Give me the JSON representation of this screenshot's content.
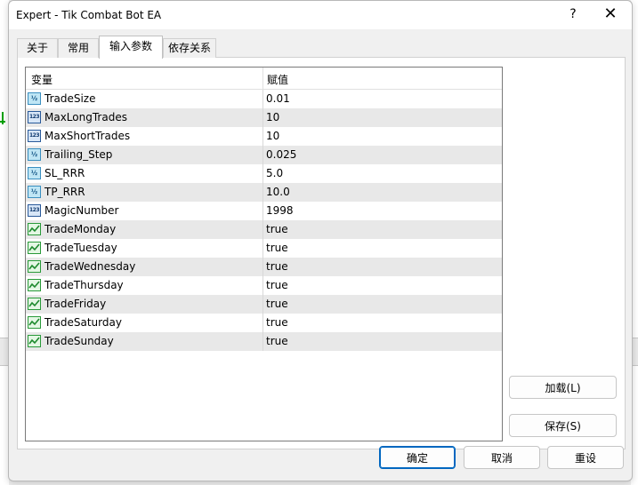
{
  "window": {
    "title": "Expert - Tik Combat Bot EA",
    "help_glyph": "?",
    "close_glyph": "✕"
  },
  "tabs": [
    {
      "label": "关于",
      "active": false
    },
    {
      "label": "常用",
      "active": false
    },
    {
      "label": "输入参数",
      "active": true
    },
    {
      "label": "依存关系",
      "active": false
    }
  ],
  "grid": {
    "columns": [
      "变量",
      "赋值"
    ],
    "rows": [
      {
        "icon": "double-icon",
        "icon_text": "½",
        "name": "TradeSize",
        "value": "0.01"
      },
      {
        "icon": "int-icon",
        "icon_text": "123",
        "name": "MaxLongTrades",
        "value": "10"
      },
      {
        "icon": "int-icon",
        "icon_text": "123",
        "name": "MaxShortTrades",
        "value": "10"
      },
      {
        "icon": "double-icon",
        "icon_text": "½",
        "name": "Trailing_Step",
        "value": "0.025"
      },
      {
        "icon": "double-icon",
        "icon_text": "½",
        "name": "SL_RRR",
        "value": "5.0"
      },
      {
        "icon": "double-icon",
        "icon_text": "½",
        "name": "TP_RRR",
        "value": "10.0"
      },
      {
        "icon": "int-icon",
        "icon_text": "123",
        "name": "MagicNumber",
        "value": "1998"
      },
      {
        "icon": "bool-icon",
        "icon_text": "",
        "name": "TradeMonday",
        "value": "true"
      },
      {
        "icon": "bool-icon",
        "icon_text": "",
        "name": "TradeTuesday",
        "value": "true"
      },
      {
        "icon": "bool-icon",
        "icon_text": "",
        "name": "TradeWednesday",
        "value": "true"
      },
      {
        "icon": "bool-icon",
        "icon_text": "",
        "name": "TradeThursday",
        "value": "true"
      },
      {
        "icon": "bool-icon",
        "icon_text": "",
        "name": "TradeFriday",
        "value": "true"
      },
      {
        "icon": "bool-icon",
        "icon_text": "",
        "name": "TradeSaturday",
        "value": "true"
      },
      {
        "icon": "bool-icon",
        "icon_text": "",
        "name": "TradeSunday",
        "value": "true"
      }
    ]
  },
  "buttons": {
    "load": "加载(L)",
    "save": "保存(S)",
    "ok": "确定",
    "cancel": "取消",
    "reset": "重设"
  },
  "colors": {
    "accent": "#0067c0",
    "alt_row": "#e8e8e8"
  }
}
